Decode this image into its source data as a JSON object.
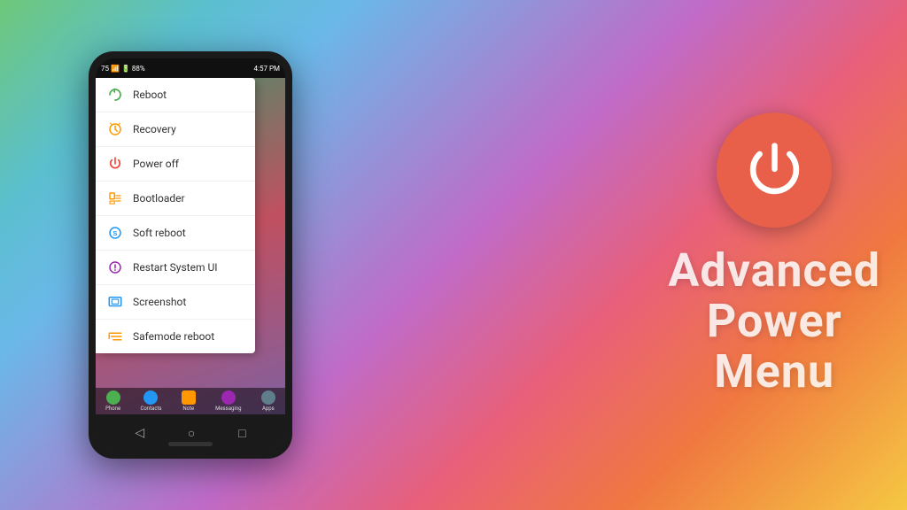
{
  "background": {
    "gradient": "multicolor"
  },
  "title": {
    "line1": "Advanced",
    "line2": "Power",
    "line3": "Menu"
  },
  "power_icon": {
    "label": "power-icon",
    "color": "#e8604a"
  },
  "phone": {
    "status_bar": {
      "left": "75",
      "right": "4:57 PM"
    },
    "menu": {
      "items": [
        {
          "id": "reboot",
          "label": "Reboot",
          "icon_color": "#4CAF50",
          "icon_type": "refresh"
        },
        {
          "id": "recovery",
          "label": "Recovery",
          "icon_color": "#FF9800",
          "icon_type": "recovery"
        },
        {
          "id": "power-off",
          "label": "Power off",
          "icon_color": "#F44336",
          "icon_type": "power"
        },
        {
          "id": "bootloader",
          "label": "Bootloader",
          "icon_color": "#FF9800",
          "icon_type": "bootloader"
        },
        {
          "id": "soft-reboot",
          "label": "Soft reboot",
          "icon_color": "#2196F3",
          "icon_type": "circle-s"
        },
        {
          "id": "restart-system-ui",
          "label": "Restart System UI",
          "icon_color": "#9C27B0",
          "icon_type": "info-circle"
        },
        {
          "id": "screenshot",
          "label": "Screenshot",
          "icon_color": "#2196F3",
          "icon_type": "monitor"
        },
        {
          "id": "safemode-reboot",
          "label": "Safemode reboot",
          "icon_color": "#FF9800",
          "icon_type": "sliders"
        }
      ]
    },
    "dock": {
      "items": [
        "Phone",
        "Contacts",
        "Note",
        "Messaging",
        "Apps"
      ]
    },
    "nav": {
      "back": "◁",
      "home": "○",
      "recent": "□"
    }
  }
}
